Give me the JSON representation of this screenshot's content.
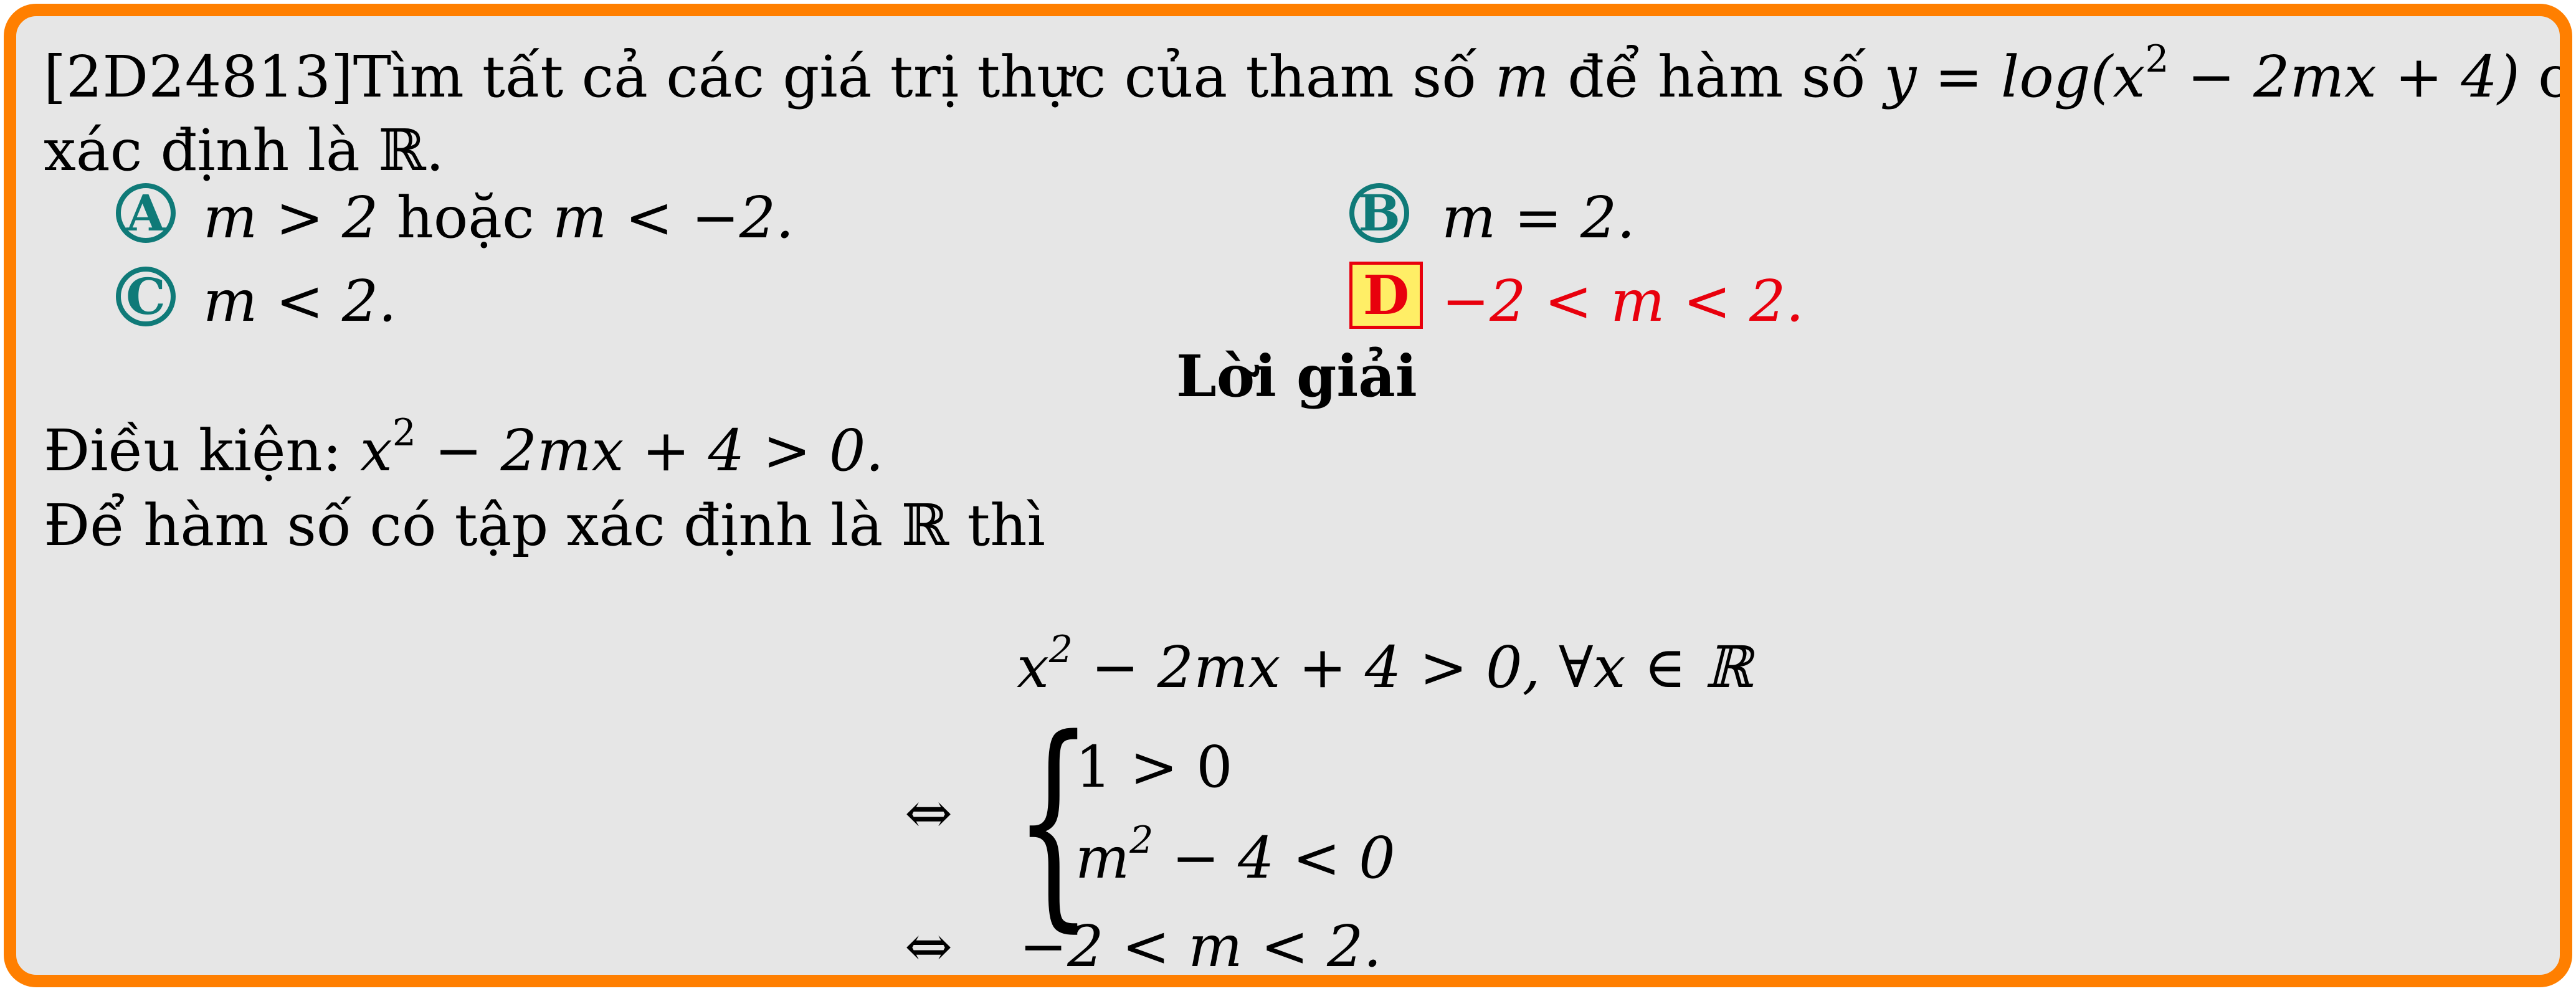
{
  "question": {
    "code": "[2D24813]",
    "line1_text": "Tìm tất cả các giá trị thực của tham số",
    "line1_var": "m",
    "line1_mid": "để hàm số",
    "line1_func_lhs": "y = log(x",
    "line1_exp": "2",
    "line1_func_rhs": " − 2mx + 4)",
    "line1_end": "có tập",
    "line2": "xác định là ℝ."
  },
  "choices": {
    "a_label": "A",
    "a_text_1": "m > 2",
    "a_text_2": "hoặc",
    "a_text_3": "m < −2.",
    "b_label": "B",
    "b_text": "m = 2.",
    "c_label": "C",
    "c_text": "m < 2.",
    "d_label": "D",
    "d_text": "−2 < m < 2."
  },
  "solution": {
    "heading": "Lời giải",
    "cond_label": "Điều kiện:",
    "cond_lhs": "x",
    "cond_exp": "2",
    "cond_rhs": " − 2mx + 4 > 0.",
    "line2": "Để hàm số có tập xác định là ℝ thì",
    "eq1_lhs": "x",
    "eq1_exp": "2",
    "eq1_rhs": " − 2mx + 4 > 0,  ∀x ∈ ℝ",
    "equiv": "⇔",
    "sys1": "1 > 0",
    "sys2_lhs": "m",
    "sys2_exp": "2",
    "sys2_rhs": " − 4 < 0",
    "final": "−2 < m < 2."
  },
  "colors": {
    "frame": "#ff7f00",
    "background": "#e6e6e6",
    "choice_circle": "#0f7a78",
    "correct": "#e8000d",
    "correct_bg": "#ffee66"
  }
}
